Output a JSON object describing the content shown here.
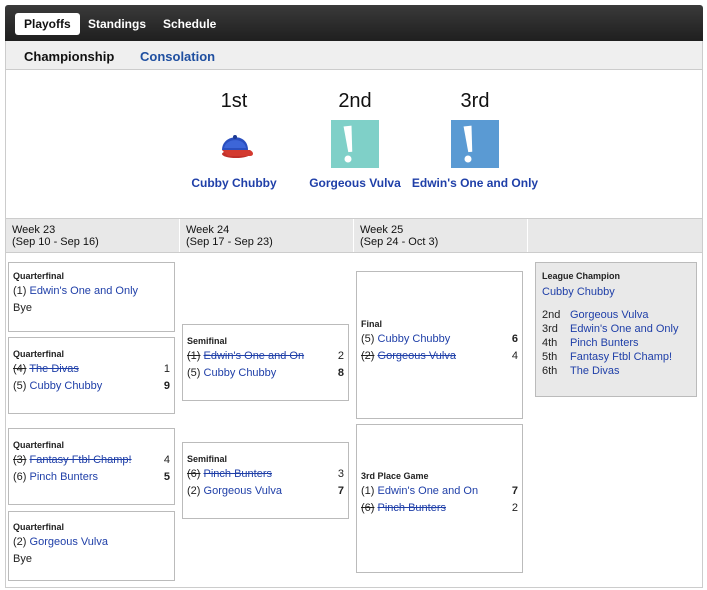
{
  "nav": {
    "tabs": [
      {
        "label": "Playoffs",
        "active": true
      },
      {
        "label": "Standings",
        "active": false
      },
      {
        "label": "Schedule",
        "active": false
      }
    ]
  },
  "subtabs": {
    "championship": "Championship",
    "consolation": "Consolation"
  },
  "podium": [
    {
      "place": "1st",
      "team": "Cubby Chubby",
      "icon": "baseball-cap-icon"
    },
    {
      "place": "2nd",
      "team": "Gorgeous Vulva",
      "icon": "exclamation-icon",
      "icon_color": "#7fd0c8"
    },
    {
      "place": "3rd",
      "team": "Edwin's One and Only",
      "icon": "exclamation-icon",
      "icon_color": "#5a9ad3"
    }
  ],
  "weeks": [
    {
      "label": "Week 23",
      "dates": "(Sep 10 - Sep 16)"
    },
    {
      "label": "Week 24",
      "dates": "(Sep 17 - Sep 23)"
    },
    {
      "label": "Week 25",
      "dates": "(Sep 24 - Oct 3)"
    }
  ],
  "week23": [
    {
      "title": "Quarterfinal",
      "rows": [
        {
          "seed": "(1)",
          "name": "Edwin's One and Only",
          "score": "",
          "result": "bye"
        }
      ],
      "bye": "Bye"
    },
    {
      "title": "Quarterfinal",
      "rows": [
        {
          "seed": "(4)",
          "name": "The Divas",
          "score": "1",
          "result": "loser"
        },
        {
          "seed": "(5)",
          "name": "Cubby Chubby",
          "score": "9",
          "result": "winner"
        }
      ]
    },
    {
      "title": "Quarterfinal",
      "rows": [
        {
          "seed": "(3)",
          "name": "Fantasy Ftbl Champ!",
          "score": "4",
          "result": "loser"
        },
        {
          "seed": "(6)",
          "name": "Pinch Bunters",
          "score": "5",
          "result": "winner"
        }
      ]
    },
    {
      "title": "Quarterfinal",
      "rows": [
        {
          "seed": "(2)",
          "name": "Gorgeous Vulva",
          "score": "",
          "result": "bye"
        }
      ],
      "bye": "Bye"
    }
  ],
  "week24": [
    {
      "title": "Semifinal",
      "rows": [
        {
          "seed": "(1)",
          "name": "Edwin's One and On",
          "score": "2",
          "result": "loser"
        },
        {
          "seed": "(5)",
          "name": "Cubby Chubby",
          "score": "8",
          "result": "winner"
        }
      ]
    },
    {
      "title": "Semifinal",
      "rows": [
        {
          "seed": "(6)",
          "name": "Pinch Bunters",
          "score": "3",
          "result": "loser"
        },
        {
          "seed": "(2)",
          "name": "Gorgeous Vulva",
          "score": "7",
          "result": "winner"
        }
      ]
    }
  ],
  "week25": [
    {
      "title": "Final",
      "rows": [
        {
          "seed": "(5)",
          "name": "Cubby Chubby",
          "score": "6",
          "result": "winner"
        },
        {
          "seed": "(2)",
          "name": "Gorgeous Vulva",
          "score": "4",
          "result": "loser"
        }
      ]
    },
    {
      "title": "3rd Place Game",
      "rows": [
        {
          "seed": "(1)",
          "name": "Edwin's One and On",
          "score": "7",
          "result": "winner"
        },
        {
          "seed": "(6)",
          "name": "Pinch Bunters",
          "score": "2",
          "result": "loser"
        }
      ]
    }
  ],
  "champion": {
    "title": "League Champion",
    "name": "Cubby Chubby",
    "standings": [
      {
        "place": "2nd",
        "name": "Gorgeous Vulva"
      },
      {
        "place": "3rd",
        "name": "Edwin's One and Only"
      },
      {
        "place": "4th",
        "name": "Pinch Bunters"
      },
      {
        "place": "5th",
        "name": "Fantasy Ftbl Champ!"
      },
      {
        "place": "6th",
        "name": "The Divas"
      }
    ]
  }
}
